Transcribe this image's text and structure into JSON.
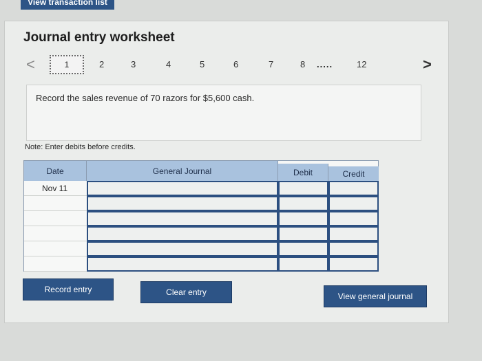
{
  "top_button": {
    "label": "View transaction list"
  },
  "worksheet": {
    "title": "Journal entry worksheet",
    "pages": [
      "1",
      "2",
      "3",
      "4",
      "5",
      "6",
      "7",
      "8",
      "12"
    ],
    "current_page": "1",
    "ellipsis": ".....",
    "nav_prev": "<",
    "nav_next": ">",
    "instruction": "Record the sales revenue of 70 razors for $5,600 cash.",
    "note": "Note: Enter debits before credits."
  },
  "journal": {
    "headers": {
      "date": "Date",
      "account": "General Journal",
      "debit": "Debit",
      "credit": "Credit"
    },
    "rows": [
      {
        "date": "Nov 11",
        "account": "",
        "debit": "",
        "credit": ""
      },
      {
        "date": "",
        "account": "",
        "debit": "",
        "credit": ""
      },
      {
        "date": "",
        "account": "",
        "debit": "",
        "credit": ""
      },
      {
        "date": "",
        "account": "",
        "debit": "",
        "credit": ""
      },
      {
        "date": "",
        "account": "",
        "debit": "",
        "credit": ""
      },
      {
        "date": "",
        "account": "",
        "debit": "",
        "credit": ""
      }
    ]
  },
  "buttons": {
    "record": "Record entry",
    "clear": "Clear entry",
    "view_journal": "View general journal"
  },
  "colors": {
    "button": "#2d5486",
    "header": "#a9c2de",
    "border": "#2c4f80"
  }
}
